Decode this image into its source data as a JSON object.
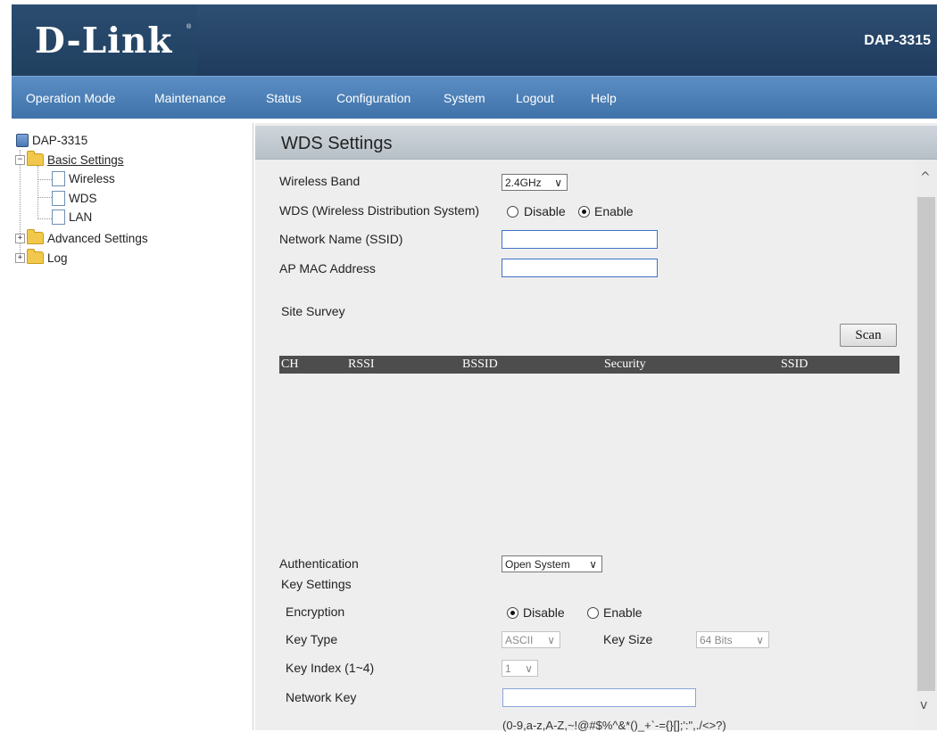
{
  "header": {
    "logo_text": "D-Link",
    "logo_reg": "®",
    "model": "DAP-3315"
  },
  "nav": {
    "items": [
      {
        "label": "Operation Mode"
      },
      {
        "label": "Maintenance"
      },
      {
        "label": "Status"
      },
      {
        "label": "Configuration"
      },
      {
        "label": "System"
      },
      {
        "label": "Logout"
      },
      {
        "label": "Help"
      }
    ]
  },
  "tree": {
    "root": "DAP-3315",
    "basic_settings": "Basic Settings",
    "wireless": "Wireless",
    "wds": "WDS",
    "lan": "LAN",
    "advanced_settings": "Advanced Settings",
    "log": "Log",
    "collapse_symbol": "−",
    "expand_symbol": "+"
  },
  "page": {
    "title": "WDS Settings",
    "wireless_band": {
      "label": "Wireless Band",
      "value": "2.4GHz"
    },
    "wds": {
      "label": "WDS (Wireless Distribution System)",
      "disable_label": "Disable",
      "enable_label": "Enable",
      "selected": "Enable"
    },
    "ssid": {
      "label": "Network Name (SSID)",
      "value": ""
    },
    "ap_mac": {
      "label": "AP MAC Address",
      "value": ""
    },
    "site_survey": {
      "label": "Site Survey",
      "scan_label": "Scan"
    },
    "table": {
      "columns": [
        "CH",
        "RSSI",
        "BSSID",
        "Security",
        "SSID"
      ],
      "rows": []
    },
    "authentication": {
      "label": "Authentication",
      "value": "Open System"
    },
    "key_settings": {
      "label": "Key Settings"
    },
    "encryption": {
      "label": "Encryption",
      "disable_label": "Disable",
      "enable_label": "Enable",
      "selected": "Disable"
    },
    "key_type": {
      "label": "Key Type",
      "value": "ASCII"
    },
    "key_size": {
      "label": "Key Size",
      "value": "64 Bits"
    },
    "key_index": {
      "label": "Key Index (1~4)",
      "value": "1"
    },
    "network_key": {
      "label": "Network Key",
      "value": ""
    },
    "key_hint": "(0-9,a-z,A-Z,~!@#$%^&*()_+`-={}[];':\",./<>?)"
  },
  "scroll": {
    "up": "^",
    "down": "v"
  },
  "colors": {
    "header_bg": "#1f3b5d",
    "nav_bg": "#4a7db3",
    "table_header_bg": "#4d4d4d",
    "content_bg": "#eeeeee"
  }
}
